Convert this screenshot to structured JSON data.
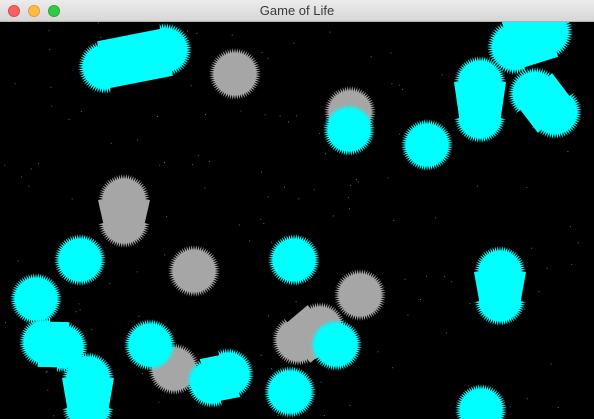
{
  "window": {
    "title": "Game of Life"
  },
  "colors": {
    "background": "#000000",
    "alive": "#00ffff",
    "dying": "#a6a6a6",
    "star": "#666666"
  },
  "cell_states": [
    "alive",
    "dying"
  ]
}
